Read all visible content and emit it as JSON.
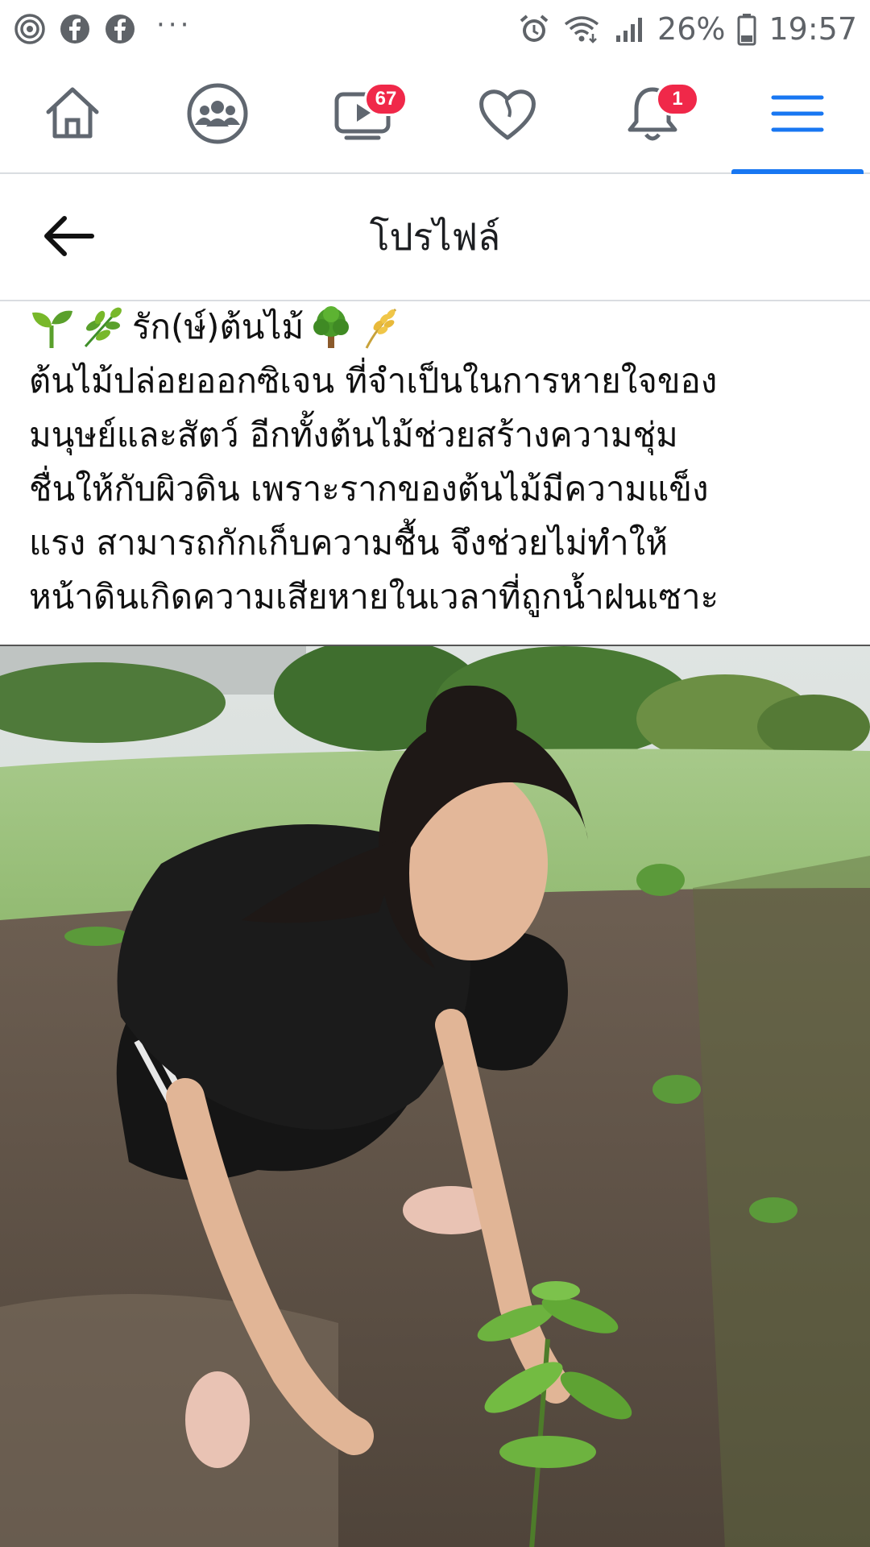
{
  "status_bar": {
    "icons_left": [
      "threads-icon",
      "facebook-icon",
      "facebook-icon"
    ],
    "more_dots": "···",
    "battery_percent": "26%",
    "time": "19:57"
  },
  "nav": {
    "items": [
      {
        "name": "home",
        "icon": "home-icon"
      },
      {
        "name": "groups",
        "icon": "groups-icon"
      },
      {
        "name": "watch",
        "icon": "video-icon",
        "badge": "67"
      },
      {
        "name": "dating",
        "icon": "heart-icon"
      },
      {
        "name": "notifications",
        "icon": "bell-icon",
        "badge": "1"
      },
      {
        "name": "menu",
        "icon": "menu-icon",
        "active": true
      }
    ],
    "active_color": "#1877f2",
    "badge_color": "#f02849"
  },
  "header": {
    "title": "โปรไฟล์",
    "back_icon": "back-arrow-icon"
  },
  "post": {
    "first_line": "รัก(ษ์)ต้นไม้",
    "lines": [
      "ต้นไม้ปล่อยออกซิเจน ที่จำเป็นในการหายใจของ",
      "มนุษย์และสัตว์  อีกทั้งต้นไม้ช่วยสร้างความชุ่ม",
      "ชื่นให้กับผิวดิน เพราะรากของต้นไม้มีความแข็ง",
      "แรง สามารถกักเก็บความชื้น  จึงช่วยไม่ทำให้",
      "หน้าดินเกิดความเสียหายในเวลาที่ถูกน้ำฝนเซาะ"
    ],
    "emojis": [
      "seedling-emoji",
      "herb-emoji",
      "tree-emoji",
      "rice-emoji"
    ]
  },
  "photo": {
    "subject": "woman-planting-seedling-photo"
  }
}
